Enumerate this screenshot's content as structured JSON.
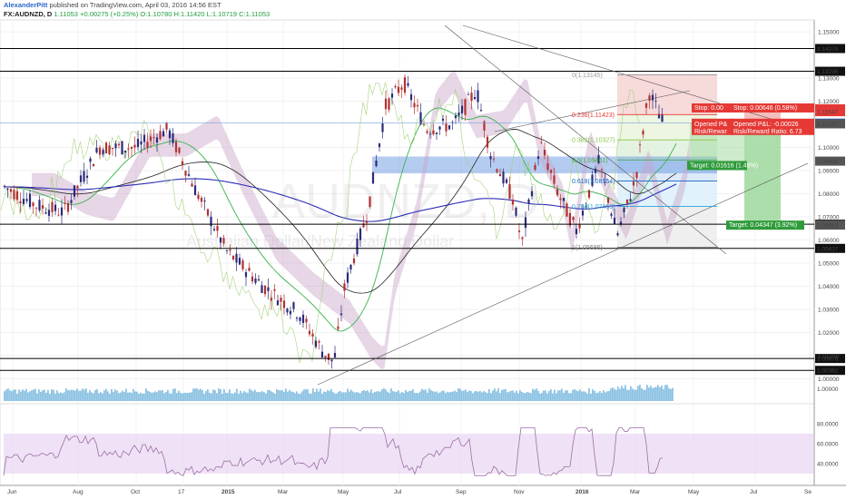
{
  "header": {
    "author": "AlexanderPitt",
    "published": "published on TradingView.com, April 03, 2016 14:56 EST",
    "symbol": "FX:AUDNZD, D",
    "price": "1.11053",
    "change": "+0.00275 (+0.25%)",
    "open": "O:1.10780",
    "high": "H:1.11420",
    "low": "L:1.10719",
    "close": "C:1.11053"
  },
  "watermark": "AUDNZD, D",
  "watermark_sub": "Australian Dollar/New Zealand Dollar",
  "chart_data": {
    "type": "candlestick",
    "x_ticks": [
      "Jun",
      "Aug",
      "Oct",
      "17",
      "2015",
      "Mar",
      "May",
      "Jul",
      "Sep",
      "Nov",
      "2016",
      "Mar",
      "May",
      "Jul",
      "Se"
    ],
    "y_ticks": [
      "1.15000",
      "1.13000",
      "1.12000",
      "1.10000",
      "1.09000",
      "1.08000",
      "1.07000",
      "1.06000",
      "1.05000",
      "1.04000",
      "1.03000",
      "1.02000",
      "1.01000",
      "1.00000"
    ],
    "ylim": [
      0.999,
      1.152
    ],
    "horizontal_levels": [
      {
        "value": 1.14279,
        "label": "1.14279"
      },
      {
        "value": 1.13295,
        "label": "1.13295"
      },
      {
        "value": 1.0668,
        "label": "1.06680"
      },
      {
        "value": 1.05637,
        "label": "1.05637"
      },
      {
        "value": 1.00876,
        "label": "1.00876"
      },
      {
        "value": 1.00362,
        "label": "1.00362"
      }
    ],
    "price_labels": [
      {
        "value": 1.11673,
        "label": "1.11673",
        "color": "#e53935"
      },
      {
        "value": 1.11547,
        "label": "1.11547",
        "color": "#e53935"
      },
      {
        "value": 1.11053,
        "label": "1.11053",
        "color": "#1e5fd6"
      },
      {
        "value": 1.11026,
        "label": "1.11026",
        "color": "#555555"
      },
      {
        "value": 1.11027,
        "label": "1.11027",
        "color": "#555555"
      },
      {
        "value": 1.0941,
        "label": "1.09410",
        "color": "#555555"
      },
      {
        "value": 1.06644,
        "label": "1.06644",
        "color": "#555555"
      }
    ],
    "fibonacci": [
      {
        "level": "0",
        "value": 1.13145,
        "color": "#999999"
      },
      {
        "level": "0.236",
        "value": 1.11423,
        "color": "#e53935"
      },
      {
        "level": "0.382",
        "value": 1.10327,
        "color": "#8bc34a"
      },
      {
        "level": "0.5",
        "value": 1.09461,
        "color": "#4caf50"
      },
      {
        "level": "0.618",
        "value": 1.08554,
        "color": "#1565c0"
      },
      {
        "level": "0.764",
        "value": 1.07453,
        "color": "#29a0d8"
      },
      {
        "level": "1",
        "value": 1.05686,
        "color": "#777777"
      }
    ],
    "positions": [
      {
        "stop": "Stop: 0.00646 (0.58%)",
        "pnl": "Opened P&L: -0.00026",
        "rr": "Risk/Reward Ratio: 6.73",
        "target": "Target: 0.04347 (3.92%)"
      },
      {
        "stop": "Stop: 0.00",
        "pnl": "Opened P&",
        "rr": "Risk/Rewar",
        "target": "Target: 0.01616 (1.46%)"
      }
    ],
    "rsi_ticks": [
      "80.0000",
      "60.0000",
      "40.0000"
    ],
    "rsi_band": [
      30,
      70
    ],
    "volume_ticks": [
      "1.00000"
    ]
  }
}
